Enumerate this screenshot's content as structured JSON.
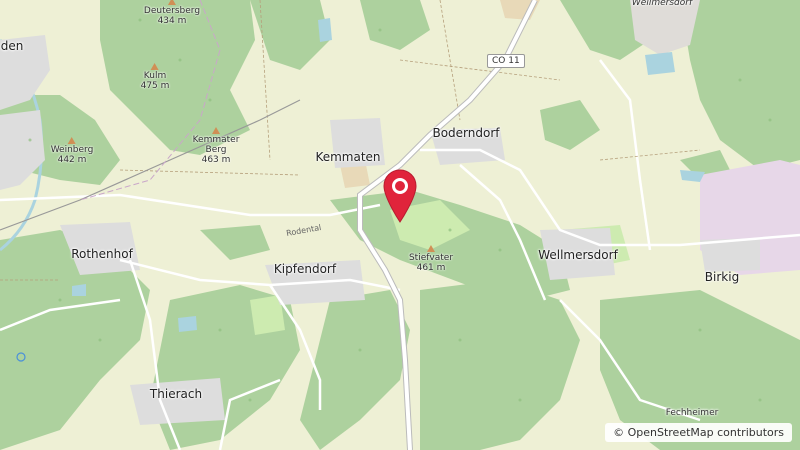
{
  "map": {
    "places": [
      {
        "id": "kemmaten",
        "label": "Kemmaten"
      },
      {
        "id": "boderndorf",
        "label": "Boderndorf"
      },
      {
        "id": "rothenhof",
        "label": "Rothenhof"
      },
      {
        "id": "kipfendorf",
        "label": "Kipfendorf"
      },
      {
        "id": "wellmersdorf",
        "label": "Wellmersdorf"
      },
      {
        "id": "birkig",
        "label": "Birkig"
      },
      {
        "id": "thierach",
        "label": "Thierach"
      },
      {
        "id": "wellmersdorf-north",
        "label": "Wellmersdorf"
      },
      {
        "id": "edge-town",
        "label": "den"
      }
    ],
    "peaks": [
      {
        "id": "deutersberg",
        "name": "Deutersberg",
        "elevation": "434 m"
      },
      {
        "id": "kulm",
        "name": "Kulm",
        "elevation": "475 m"
      },
      {
        "id": "weinberg",
        "name": "Weinberg",
        "elevation": "442 m"
      },
      {
        "id": "kemmater-berg",
        "name": "Kemmater Berg",
        "elevation": "463 m"
      },
      {
        "id": "stiefvater",
        "name": "Stiefvater",
        "elevation": "461 m"
      }
    ],
    "road_ref": "CO 11",
    "street_label": "Rodental",
    "partial_label": "Fechheimer",
    "marker_icon": "map-pin-icon",
    "marker_color": "#e0243b",
    "forest_color": "#add19e",
    "field_color": "#eef0d5",
    "attribution": "© OpenStreetMap contributors"
  }
}
